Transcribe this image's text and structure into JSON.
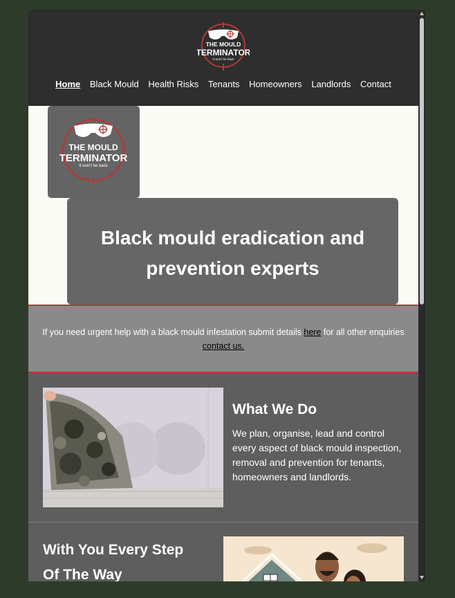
{
  "header": {
    "logo_alt": "The Mould Terminator - It won't be back",
    "nav": [
      {
        "label": "Home",
        "active": true
      },
      {
        "label": "Black Mould"
      },
      {
        "label": "Health Risks"
      },
      {
        "label": "Tenants"
      },
      {
        "label": "Homeowners"
      },
      {
        "label": "Landlords"
      },
      {
        "label": "Contact"
      }
    ]
  },
  "logo": {
    "line1": "THE MOULD",
    "line2": "TERMINATOR",
    "tagline": "It won't be back"
  },
  "hero": {
    "heading_line1": "Black mould eradication and",
    "heading_line2": "prevention experts"
  },
  "notice": {
    "text_before": "If you need urgent help with a black mould infestation submit details ",
    "link1": "here",
    "text_middle": " for all other enquiries ",
    "link2": "contact us."
  },
  "what_we_do": {
    "title": "What We Do",
    "body": "We plan, organise, lead and control every aspect of black mould inspection, removal and prevention for tenants, homeowners and landlords."
  },
  "step": {
    "title_line1": "With You Every Step",
    "title_line2": "Of The Way"
  },
  "colors": {
    "page_bg": "#2e3b2b",
    "header_bg": "#2e2e2e",
    "accent_red": "#b23a36",
    "hero_box": "#666666",
    "notice_bg": "#8a8a8a",
    "section_bg": "#5e5e5e"
  }
}
